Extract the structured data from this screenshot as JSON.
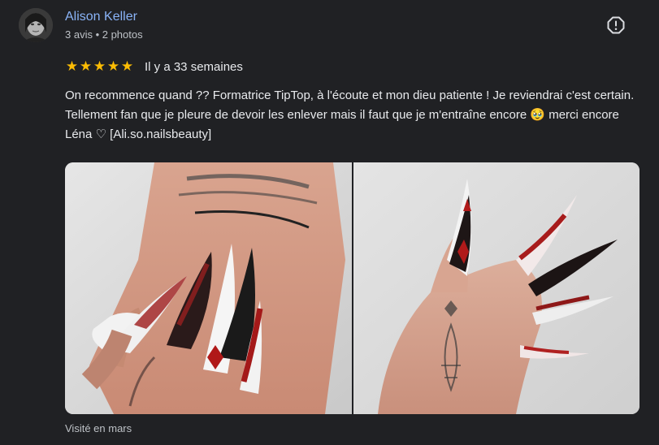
{
  "review": {
    "author": {
      "name": "Alison Keller",
      "meta": "3 avis • 2 photos"
    },
    "rating": {
      "stars": 5,
      "star_glyph": "★",
      "date": "Il y a 33 semaines"
    },
    "text": "On recommence quand ?? Formatrice TipTop, à l'écoute et mon dieu patiente ! Je reviendrai c'est certain. Tellement fan que je pleure de devoir les enlever mais il faut que je m'entraîne encore 🥹 merci encore Léna ♡ [Ali.so.nailsbeauty]",
    "visited": "Visité en mars",
    "icons": {
      "report": "report-flag-icon",
      "star": "star-icon"
    },
    "colors": {
      "background": "#202124",
      "author_name": "#8ab4f8",
      "star": "#fbbc04",
      "text": "#e8eaed",
      "secondary": "#bdc1c6"
    }
  }
}
